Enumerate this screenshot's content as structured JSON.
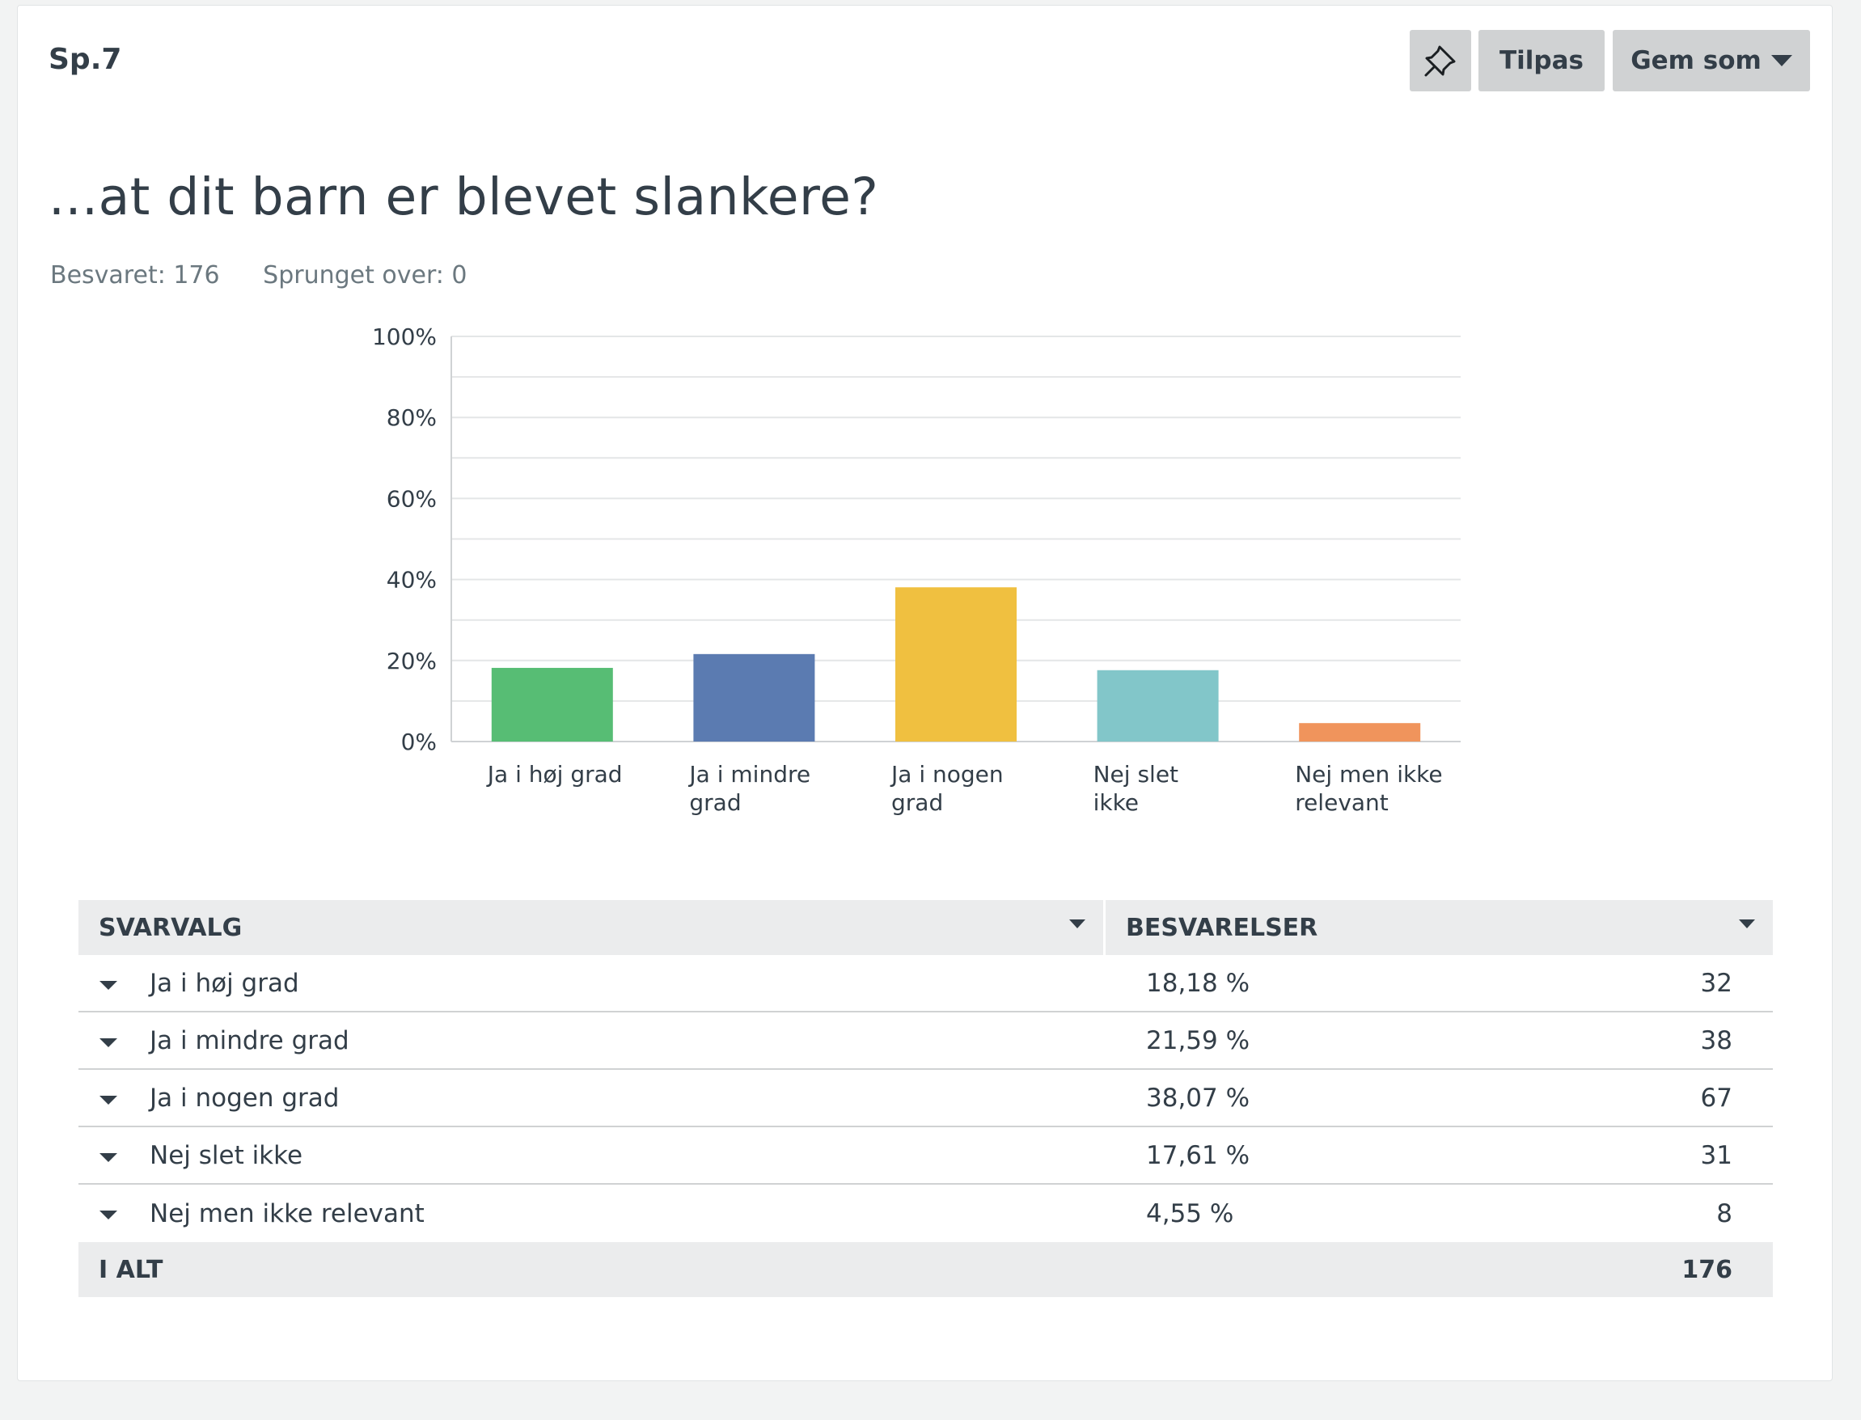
{
  "question": {
    "number": "Sp.7",
    "title": "...at dit barn er blevet slankere?",
    "answered": "Besvaret: 176",
    "skipped": "Sprunget over: 0"
  },
  "toolbar": {
    "pin_icon": "pin-icon",
    "customize_label": "Tilpas",
    "save_as_label": "Gem som"
  },
  "chart_data": {
    "type": "bar",
    "categories": [
      [
        "Ja i høj grad"
      ],
      [
        "Ja i mindre",
        "grad"
      ],
      [
        "Ja i nogen",
        "grad"
      ],
      [
        "Nej slet",
        "ikke"
      ],
      [
        "Nej men ikke",
        "relevant"
      ]
    ],
    "values": [
      18.18,
      21.59,
      38.07,
      17.61,
      4.55
    ],
    "colors": [
      "#57bd74",
      "#5b7bb1",
      "#f0c040",
      "#82c6c9",
      "#f0945c"
    ],
    "ylim": [
      0,
      100
    ],
    "yticks": [
      "0%",
      "20%",
      "40%",
      "60%",
      "80%",
      "100%"
    ],
    "grid": true
  },
  "table": {
    "col1_header": "SVARVALG",
    "col2_header": "BESVARELSER",
    "rows": [
      {
        "label": "Ja i høj grad",
        "pct": "18,18 %",
        "count": "32"
      },
      {
        "label": "Ja i mindre grad",
        "pct": "21,59 %",
        "count": "38"
      },
      {
        "label": "Ja i nogen grad",
        "pct": "38,07 %",
        "count": "67"
      },
      {
        "label": "Nej slet ikke",
        "pct": "17,61 %",
        "count": "31"
      },
      {
        "label": "Nej men ikke relevant",
        "pct": "4,55 %",
        "count": "8"
      }
    ],
    "total_label": "I ALT",
    "total_count": "176"
  }
}
